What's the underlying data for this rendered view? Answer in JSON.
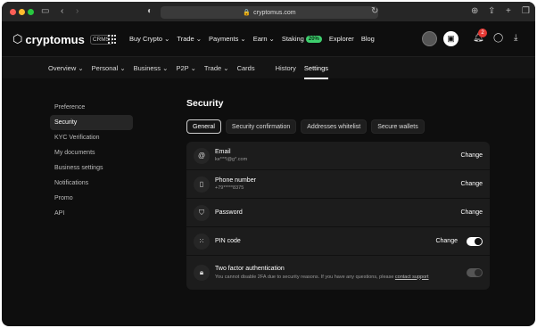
{
  "browser": {
    "url": "cryptomus.com",
    "icons": [
      "sidebar-icon",
      "back-icon",
      "forward-icon",
      "shield-icon",
      "lock-icon",
      "reload-icon",
      "download-icon",
      "share-icon",
      "new-tab-icon",
      "tabs-icon"
    ]
  },
  "header": {
    "logo_text": "cryptomus",
    "logo_badge": "CRMS",
    "menu": [
      {
        "label": "Buy Crypto",
        "dropdown": true
      },
      {
        "label": "Trade",
        "dropdown": true
      },
      {
        "label": "Payments",
        "dropdown": true
      },
      {
        "label": "Earn",
        "dropdown": true
      },
      {
        "label": "Staking",
        "badge": "20%"
      },
      {
        "label": "Explorer"
      },
      {
        "label": "Blog"
      }
    ],
    "notifications_count": "2"
  },
  "subnav": {
    "items": [
      "Overview",
      "Personal",
      "Business",
      "P2P",
      "Trade",
      "Cards",
      "History",
      "Settings"
    ],
    "active": "Settings"
  },
  "sidebar": {
    "items": [
      "Preference",
      "Security",
      "KYC Verification",
      "My documents",
      "Business settings",
      "Notifications",
      "Promo",
      "API"
    ],
    "active": "Security"
  },
  "main": {
    "title": "Security",
    "tabs": [
      "General",
      "Security confirmation",
      "Addresses whitelist",
      "Secure wallets"
    ],
    "active_tab": "General",
    "rows": [
      {
        "icon": "at-icon",
        "label": "Email",
        "sub": "ke***l@g*.com",
        "action": "Change"
      },
      {
        "icon": "phone-icon",
        "label": "Phone number",
        "sub": "+79*****8375",
        "action": "Change"
      },
      {
        "icon": "shield-check-icon",
        "label": "Password",
        "action": "Change"
      },
      {
        "icon": "keypad-icon",
        "label": "PIN code",
        "action": "Change",
        "toggle": "on"
      },
      {
        "icon": "padlock-icon",
        "label": "Two factor authentication",
        "sub": "You cannot disable 2FA due to security reasons. If you have any questions, please",
        "link": "contact support",
        "toggle": "on-disabled"
      }
    ]
  }
}
